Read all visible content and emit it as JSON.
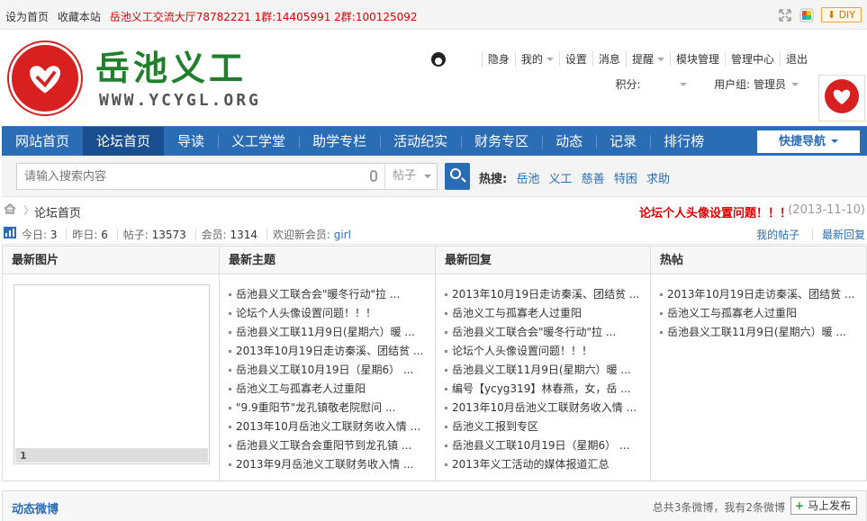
{
  "topbar": {
    "set_home": "设为首页",
    "bookmark": "收藏本站",
    "qq_groups": "岳池义工交流大厅78782221 1群:14405991 2群:100125092",
    "diy": "DIY"
  },
  "logo": {
    "title": "岳池义工",
    "url": "WWW.YCYGL.ORG"
  },
  "user_menu": {
    "items": [
      "隐身",
      "我的",
      "设置",
      "消息",
      "提醒",
      "模块管理",
      "管理中心",
      "退出"
    ],
    "points_label": "积分:",
    "group_label": "用户组: 管理员"
  },
  "nav": {
    "items": [
      "网站首页",
      "论坛首页",
      "导读",
      "义工学堂",
      "助学专栏",
      "活动纪实",
      "财务专区",
      "动态",
      "记录",
      "排行榜"
    ],
    "quick_nav": "快捷导航"
  },
  "search": {
    "placeholder": "请输入搜索内容",
    "type": "帖子",
    "hot_label": "热搜:",
    "hot_tags": [
      "岳池",
      "义工",
      "慈善",
      "特困",
      "求助"
    ]
  },
  "breadcrumb": {
    "current": "论坛首页",
    "notice": "论坛个人头像设置问题！！！",
    "notice_date": "(2013-11-10)"
  },
  "stats": {
    "today_label": "今日:",
    "today": "3",
    "yesterday_label": "昨日:",
    "yesterday": "6",
    "posts_label": "帖子:",
    "posts": "13573",
    "members_label": "会员:",
    "members": "1314",
    "welcome_label": "欢迎新会员:",
    "new_member": "girl",
    "my_posts": "我的帖子",
    "latest_reply": "最新回复"
  },
  "columns": {
    "pics": {
      "title": "最新图片",
      "index": "1"
    },
    "latest_topics": {
      "title": "最新主题",
      "items": [
        "岳池县义工联合会\"暖冬行动\"拉 ...",
        "论坛个人头像设置问题！！！",
        "岳池县义工联11月9日(星期六）暖 ...",
        "2013年10月19日走访秦溪、团结贫 ...",
        "岳池县义工联10月19日（星期6） ...",
        "岳池义工与孤寡老人过重阳",
        "\"9.9重阳节\"龙孔镇敬老院慰问 ...",
        "2013年10月岳池义工联财务收入情 ...",
        "岳池县义工联合会重阳节到龙孔镇 ...",
        "2013年9月岳池义工联财务收入情 ..."
      ]
    },
    "latest_replies": {
      "title": "最新回复",
      "items": [
        "2013年10月19日走访秦溪、团结贫 ...",
        "岳池义工与孤寡老人过重阳",
        "岳池县义工联合会\"暖冬行动\"拉 ...",
        "论坛个人头像设置问题！！！",
        "岳池县义工联11月9日(星期六）暖 ...",
        "编号【ycyg319】林春燕，女，岳 ...",
        "2013年10月岳池义工联财务收入情 ...",
        "岳池义工报到专区",
        "岳池县义工联10月19日（星期6） ...",
        "2013年义工活动的媒体报道汇总"
      ]
    },
    "hot": {
      "title": "热帖",
      "items": [
        "2013年10月19日走访秦溪、团结贫 ...",
        "岳池义工与孤寡老人过重阳",
        "岳池县义工联11月9日(星期六）暖 ..."
      ]
    }
  },
  "weibo": {
    "title": "动态微博",
    "info": "总共3条微博，我有2条微博",
    "publish": "马上发布"
  }
}
